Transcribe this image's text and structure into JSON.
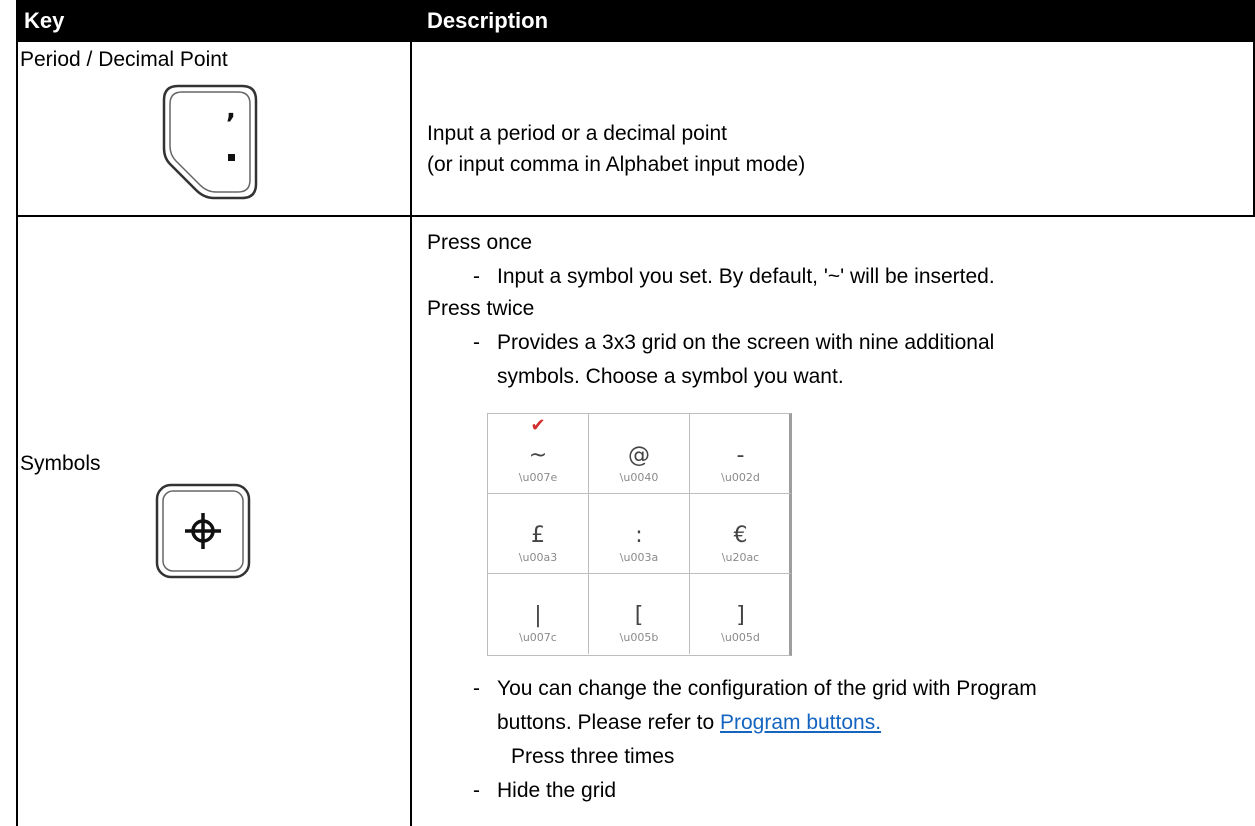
{
  "header": {
    "key": "Key",
    "description": "Description"
  },
  "rows": [
    {
      "key_label": "Period / Decimal Point",
      "key_icon": "period-key-icon",
      "key_glyph_top": ",",
      "key_glyph_bottom": "▪",
      "description_lines": [
        "Input a period or a decimal point",
        "(or input comma in Alphabet input mode)"
      ]
    },
    {
      "key_label": "Symbols",
      "key_icon": "crosshair-key-icon",
      "description": {
        "press_once": "Press once",
        "press_once_dash": "-",
        "press_once_item": "Input a symbol you set. By default, '~' will be inserted.",
        "press_twice": "Press twice",
        "press_twice_dash": "-",
        "press_twice_item_line1": "Provides a 3x3 grid on the screen with nine additional",
        "press_twice_item_line2": "symbols. Choose a symbol you want.",
        "config_dash": "-",
        "config_line1": "You can change the configuration of the grid with Program",
        "config_line2_prefix": "buttons. Please refer to ",
        "config_link": "Program buttons.",
        "press_three": "Press three times",
        "hide_dash": "-",
        "hide_item": "Hide the grid"
      },
      "grid": {
        "selected_mark": "✔",
        "cells": [
          {
            "symbol": "~",
            "code": "\\u007e"
          },
          {
            "symbol": "@",
            "code": "\\u0040"
          },
          {
            "symbol": "-",
            "code": "\\u002d"
          },
          {
            "symbol": "£",
            "code": "\\u00a3"
          },
          {
            "symbol": ":",
            "code": "\\u003a"
          },
          {
            "symbol": "€",
            "code": "\\u20ac"
          },
          {
            "symbol": "|",
            "code": "\\u007c"
          },
          {
            "symbol": "[",
            "code": "\\u005b"
          },
          {
            "symbol": "]",
            "code": "\\u005d"
          }
        ]
      }
    }
  ],
  "colors": {
    "header_bg": "#000000",
    "header_text": "#ffffff",
    "link": "#1565c0",
    "check": "#d32f2f"
  }
}
